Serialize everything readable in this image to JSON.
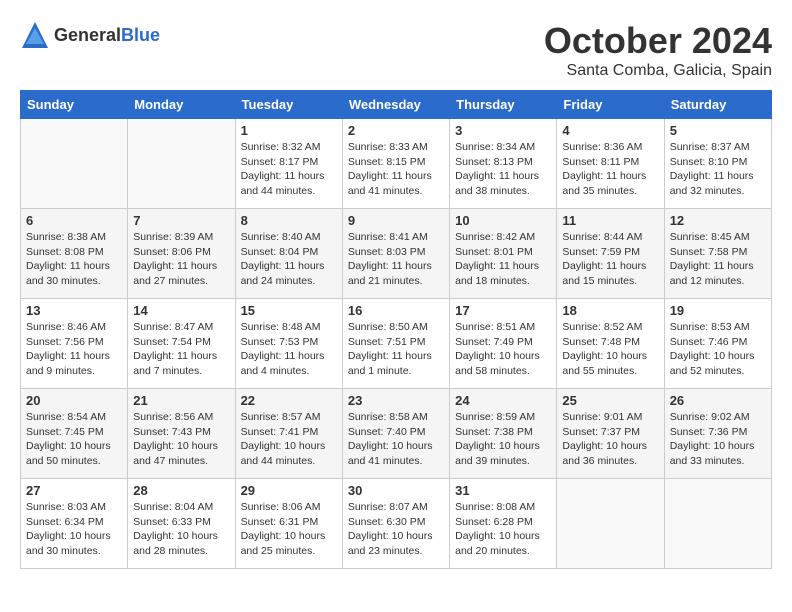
{
  "logo": {
    "general": "General",
    "blue": "Blue"
  },
  "title": "October 2024",
  "location": "Santa Comba, Galicia, Spain",
  "headers": [
    "Sunday",
    "Monday",
    "Tuesday",
    "Wednesday",
    "Thursday",
    "Friday",
    "Saturday"
  ],
  "weeks": [
    [
      {
        "day": "",
        "info": ""
      },
      {
        "day": "",
        "info": ""
      },
      {
        "day": "1",
        "info": "Sunrise: 8:32 AM\nSunset: 8:17 PM\nDaylight: 11 hours and 44 minutes."
      },
      {
        "day": "2",
        "info": "Sunrise: 8:33 AM\nSunset: 8:15 PM\nDaylight: 11 hours and 41 minutes."
      },
      {
        "day": "3",
        "info": "Sunrise: 8:34 AM\nSunset: 8:13 PM\nDaylight: 11 hours and 38 minutes."
      },
      {
        "day": "4",
        "info": "Sunrise: 8:36 AM\nSunset: 8:11 PM\nDaylight: 11 hours and 35 minutes."
      },
      {
        "day": "5",
        "info": "Sunrise: 8:37 AM\nSunset: 8:10 PM\nDaylight: 11 hours and 32 minutes."
      }
    ],
    [
      {
        "day": "6",
        "info": "Sunrise: 8:38 AM\nSunset: 8:08 PM\nDaylight: 11 hours and 30 minutes."
      },
      {
        "day": "7",
        "info": "Sunrise: 8:39 AM\nSunset: 8:06 PM\nDaylight: 11 hours and 27 minutes."
      },
      {
        "day": "8",
        "info": "Sunrise: 8:40 AM\nSunset: 8:04 PM\nDaylight: 11 hours and 24 minutes."
      },
      {
        "day": "9",
        "info": "Sunrise: 8:41 AM\nSunset: 8:03 PM\nDaylight: 11 hours and 21 minutes."
      },
      {
        "day": "10",
        "info": "Sunrise: 8:42 AM\nSunset: 8:01 PM\nDaylight: 11 hours and 18 minutes."
      },
      {
        "day": "11",
        "info": "Sunrise: 8:44 AM\nSunset: 7:59 PM\nDaylight: 11 hours and 15 minutes."
      },
      {
        "day": "12",
        "info": "Sunrise: 8:45 AM\nSunset: 7:58 PM\nDaylight: 11 hours and 12 minutes."
      }
    ],
    [
      {
        "day": "13",
        "info": "Sunrise: 8:46 AM\nSunset: 7:56 PM\nDaylight: 11 hours and 9 minutes."
      },
      {
        "day": "14",
        "info": "Sunrise: 8:47 AM\nSunset: 7:54 PM\nDaylight: 11 hours and 7 minutes."
      },
      {
        "day": "15",
        "info": "Sunrise: 8:48 AM\nSunset: 7:53 PM\nDaylight: 11 hours and 4 minutes."
      },
      {
        "day": "16",
        "info": "Sunrise: 8:50 AM\nSunset: 7:51 PM\nDaylight: 11 hours and 1 minute."
      },
      {
        "day": "17",
        "info": "Sunrise: 8:51 AM\nSunset: 7:49 PM\nDaylight: 10 hours and 58 minutes."
      },
      {
        "day": "18",
        "info": "Sunrise: 8:52 AM\nSunset: 7:48 PM\nDaylight: 10 hours and 55 minutes."
      },
      {
        "day": "19",
        "info": "Sunrise: 8:53 AM\nSunset: 7:46 PM\nDaylight: 10 hours and 52 minutes."
      }
    ],
    [
      {
        "day": "20",
        "info": "Sunrise: 8:54 AM\nSunset: 7:45 PM\nDaylight: 10 hours and 50 minutes."
      },
      {
        "day": "21",
        "info": "Sunrise: 8:56 AM\nSunset: 7:43 PM\nDaylight: 10 hours and 47 minutes."
      },
      {
        "day": "22",
        "info": "Sunrise: 8:57 AM\nSunset: 7:41 PM\nDaylight: 10 hours and 44 minutes."
      },
      {
        "day": "23",
        "info": "Sunrise: 8:58 AM\nSunset: 7:40 PM\nDaylight: 10 hours and 41 minutes."
      },
      {
        "day": "24",
        "info": "Sunrise: 8:59 AM\nSunset: 7:38 PM\nDaylight: 10 hours and 39 minutes."
      },
      {
        "day": "25",
        "info": "Sunrise: 9:01 AM\nSunset: 7:37 PM\nDaylight: 10 hours and 36 minutes."
      },
      {
        "day": "26",
        "info": "Sunrise: 9:02 AM\nSunset: 7:36 PM\nDaylight: 10 hours and 33 minutes."
      }
    ],
    [
      {
        "day": "27",
        "info": "Sunrise: 8:03 AM\nSunset: 6:34 PM\nDaylight: 10 hours and 30 minutes."
      },
      {
        "day": "28",
        "info": "Sunrise: 8:04 AM\nSunset: 6:33 PM\nDaylight: 10 hours and 28 minutes."
      },
      {
        "day": "29",
        "info": "Sunrise: 8:06 AM\nSunset: 6:31 PM\nDaylight: 10 hours and 25 minutes."
      },
      {
        "day": "30",
        "info": "Sunrise: 8:07 AM\nSunset: 6:30 PM\nDaylight: 10 hours and 23 minutes."
      },
      {
        "day": "31",
        "info": "Sunrise: 8:08 AM\nSunset: 6:28 PM\nDaylight: 10 hours and 20 minutes."
      },
      {
        "day": "",
        "info": ""
      },
      {
        "day": "",
        "info": ""
      }
    ]
  ]
}
